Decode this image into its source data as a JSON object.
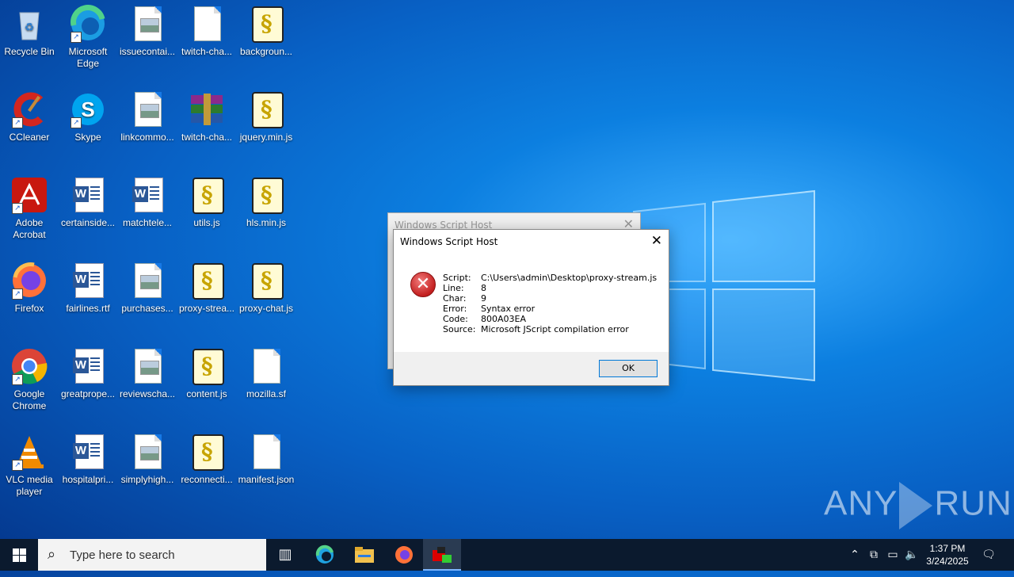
{
  "desktop": {
    "icons": [
      {
        "label": "Recycle Bin",
        "icon": "recycle-bin-icon"
      },
      {
        "label": "Microsoft Edge",
        "icon": "edge-icon"
      },
      {
        "label": "issuecontai...",
        "icon": "image-file-icon"
      },
      {
        "label": "twitch-cha...",
        "icon": "blank-file-icon"
      },
      {
        "label": "backgroun...",
        "icon": "script-file-icon"
      },
      {
        "label": "CCleaner",
        "icon": "ccleaner-icon"
      },
      {
        "label": "Skype",
        "icon": "skype-icon"
      },
      {
        "label": "linkcommo...",
        "icon": "image-file-icon"
      },
      {
        "label": "twitch-cha...",
        "icon": "winrar-archive-icon"
      },
      {
        "label": "jquery.min.js",
        "icon": "script-file-icon"
      },
      {
        "label": "Adobe Acrobat",
        "icon": "acrobat-icon"
      },
      {
        "label": "certainside...",
        "icon": "word-doc-icon"
      },
      {
        "label": "matchtele...",
        "icon": "word-doc-icon"
      },
      {
        "label": "utils.js",
        "icon": "script-file-icon"
      },
      {
        "label": "hls.min.js",
        "icon": "script-file-icon"
      },
      {
        "label": "Firefox",
        "icon": "firefox-icon"
      },
      {
        "label": "fairlines.rtf",
        "icon": "word-doc-icon"
      },
      {
        "label": "purchases...",
        "icon": "image-file-icon"
      },
      {
        "label": "proxy-strea...",
        "icon": "script-file-icon"
      },
      {
        "label": "proxy-chat.js",
        "icon": "script-file-icon"
      },
      {
        "label": "Google Chrome",
        "icon": "chrome-icon"
      },
      {
        "label": "greatprope...",
        "icon": "word-doc-icon"
      },
      {
        "label": "reviewscha...",
        "icon": "image-file-icon"
      },
      {
        "label": "content.js",
        "icon": "script-file-icon"
      },
      {
        "label": "mozilla.sf",
        "icon": "blank-file-icon"
      },
      {
        "label": "VLC media player",
        "icon": "vlc-icon"
      },
      {
        "label": "hospitalpri...",
        "icon": "word-doc-icon"
      },
      {
        "label": "simplyhigh...",
        "icon": "image-file-icon"
      },
      {
        "label": "reconnecti...",
        "icon": "script-file-icon"
      },
      {
        "label": "manifest.json",
        "icon": "blank-file-icon"
      }
    ]
  },
  "back_dialog": {
    "title": "Windows Script Host"
  },
  "dialog": {
    "title": "Windows Script Host",
    "fields": [
      {
        "key": "Script:",
        "value": "C:\\Users\\admin\\Desktop\\proxy-stream.js"
      },
      {
        "key": "Line:",
        "value": "8"
      },
      {
        "key": "Char:",
        "value": "9"
      },
      {
        "key": "Error:",
        "value": "Syntax error"
      },
      {
        "key": "Code:",
        "value": "800A03EA"
      },
      {
        "key": "Source:",
        "value": "Microsoft JScript compilation error"
      }
    ],
    "ok_label": "OK"
  },
  "taskbar": {
    "search_placeholder": "Type here to search",
    "time": "1:37 PM",
    "date": "3/24/2025"
  },
  "watermark": {
    "left": "ANY",
    "right": "RUN"
  }
}
